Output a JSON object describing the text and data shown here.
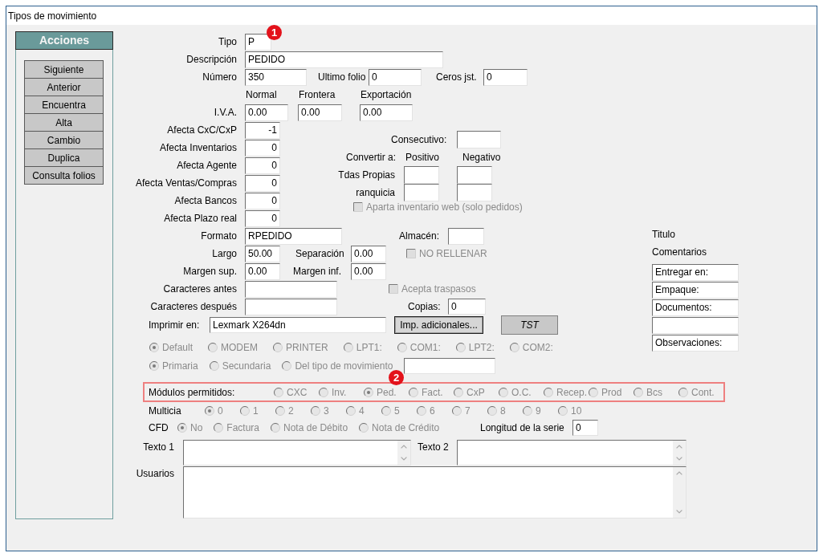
{
  "window": {
    "title": "Tipos de movimiento"
  },
  "acciones": {
    "title": "Acciones",
    "buttons": [
      "Siguiente",
      "Anterior",
      "Encuentra",
      "Alta",
      "Cambio",
      "Duplica",
      "Consulta folios"
    ]
  },
  "tipo": {
    "label": "Tipo",
    "value": "P",
    "callout": "1"
  },
  "descripcion": {
    "label": "Descripción",
    "value": "PEDIDO"
  },
  "numero": {
    "label": "Número",
    "value": "350"
  },
  "ultimo_folio": {
    "label": "Ultimo folio",
    "value": "0"
  },
  "ceros_jst": {
    "label": "Ceros jst.",
    "value": "0"
  },
  "iva": {
    "label": "I.V.A.",
    "columns": [
      {
        "heading": "Normal",
        "value": "0.00"
      },
      {
        "heading": "Frontera",
        "value": "0.00"
      },
      {
        "heading": "Exportación",
        "value": "0.00"
      }
    ]
  },
  "afecta": [
    {
      "label": "Afecta CxC/CxP",
      "value": "-1"
    },
    {
      "label": "Afecta Inventarios",
      "value": "0"
    },
    {
      "label": "Afecta Agente",
      "value": "0"
    },
    {
      "label": "Afecta Ventas/Compras",
      "value": "0"
    },
    {
      "label": "Afecta Bancos",
      "value": "0"
    },
    {
      "label": "Afecta Plazo real",
      "value": "0"
    }
  ],
  "consecutivo": {
    "label": "Consecutivo:"
  },
  "convertir": {
    "label": "Convertir a:",
    "columns": [
      "Positivo",
      "Negativo"
    ],
    "rows": [
      {
        "label": "Tdas Propias"
      },
      {
        "label": "ranquicia"
      }
    ]
  },
  "aparta_inventario": {
    "label": "Aparta inventario web (solo pedidos)",
    "checked": false,
    "disabled": true
  },
  "formato": {
    "label": "Formato",
    "value": "RPEDIDO"
  },
  "almacen": {
    "label": "Almacén:"
  },
  "largo": {
    "label": "Largo",
    "value": "50.00"
  },
  "separacion": {
    "label": "Separación",
    "value": "0.00"
  },
  "no_rellenar": {
    "label": "NO RELLENAR",
    "checked": false,
    "disabled": true
  },
  "margen_sup": {
    "label": "Margen sup.",
    "value": "0.00"
  },
  "margen_inf": {
    "label": "Margen inf.",
    "value": "0.00"
  },
  "caracteres_antes": {
    "label": "Caracteres antes"
  },
  "acepta_traspasos": {
    "label": "Acepta traspasos",
    "checked": false,
    "disabled": true
  },
  "caracteres_despues": {
    "label": "Caracteres después"
  },
  "copias": {
    "label": "Copias:",
    "value": "0"
  },
  "imprimir_en": {
    "label": "Imprimir en:",
    "value": "Lexmark X264dn"
  },
  "buttons": [
    {
      "label": "Imp. adicionales...",
      "focused": true
    },
    {
      "label": "TST",
      "focused": false
    }
  ],
  "titulo": {
    "label": "Titulo"
  },
  "comentarios": {
    "label": "Comentarios",
    "lines": [
      {
        "kind": "text",
        "value": "Entregar en:"
      },
      {
        "kind": "text",
        "value": "Empaque:"
      },
      {
        "kind": "text",
        "value": "Documentos:"
      },
      {
        "kind": "blank"
      },
      {
        "kind": "text",
        "value": "Observaciones:"
      }
    ]
  },
  "salida": {
    "disabled": true,
    "options": [
      {
        "label": "Default",
        "selected": true
      },
      {
        "label": "MODEM",
        "selected": false
      },
      {
        "label": "PRINTER",
        "selected": false
      },
      {
        "label": "LPT1:",
        "selected": false
      },
      {
        "label": "COM1:",
        "selected": false
      },
      {
        "label": "LPT2:",
        "selected": false
      },
      {
        "label": "COM2:",
        "selected": false
      }
    ]
  },
  "impresora": {
    "disabled": true,
    "options": [
      {
        "label": "Primaria",
        "selected": true
      },
      {
        "label": "Secundaria",
        "selected": false
      },
      {
        "label": "Del tipo de movimiento",
        "selected": false
      }
    ]
  },
  "modulos_permitidos": {
    "label": "Módulos permitidos:",
    "callout": "2",
    "disabled": true,
    "options": [
      {
        "label": "CXC",
        "selected": false
      },
      {
        "label": "Inv.",
        "selected": false
      },
      {
        "label": "Ped.",
        "selected": true
      },
      {
        "label": "Fact.",
        "selected": false
      },
      {
        "label": "CxP",
        "selected": false
      },
      {
        "label": "O.C.",
        "selected": false
      },
      {
        "label": "Recep.",
        "selected": false
      },
      {
        "label": "Prod",
        "selected": false
      },
      {
        "label": "Bcs",
        "selected": false
      },
      {
        "label": "Cont.",
        "selected": false
      }
    ]
  },
  "multicia": {
    "label": "Multicia",
    "disabled": true,
    "options": [
      {
        "label": "0",
        "selected": true
      },
      {
        "label": "1",
        "selected": false
      },
      {
        "label": "2",
        "selected": false
      },
      {
        "label": "3",
        "selected": false
      },
      {
        "label": "4",
        "selected": false
      },
      {
        "label": "5",
        "selected": false
      },
      {
        "label": "6",
        "selected": false
      },
      {
        "label": "7",
        "selected": false
      },
      {
        "label": "8",
        "selected": false
      },
      {
        "label": "9",
        "selected": false
      },
      {
        "label": "10",
        "selected": false
      }
    ]
  },
  "cfd": {
    "label": "CFD",
    "disabled": true,
    "options": [
      {
        "label": "No",
        "selected": true
      },
      {
        "label": "Factura",
        "selected": false
      },
      {
        "label": "Nota de Débito",
        "selected": false
      },
      {
        "label": "Nota de Crédito",
        "selected": false
      }
    ]
  },
  "longitud_serie": {
    "label": "Longitud de la serie",
    "value": "0"
  },
  "textos": [
    {
      "label": "Texto 1"
    },
    {
      "label": "Texto 2"
    }
  ],
  "usuarios": {
    "label": "Usuarios"
  }
}
